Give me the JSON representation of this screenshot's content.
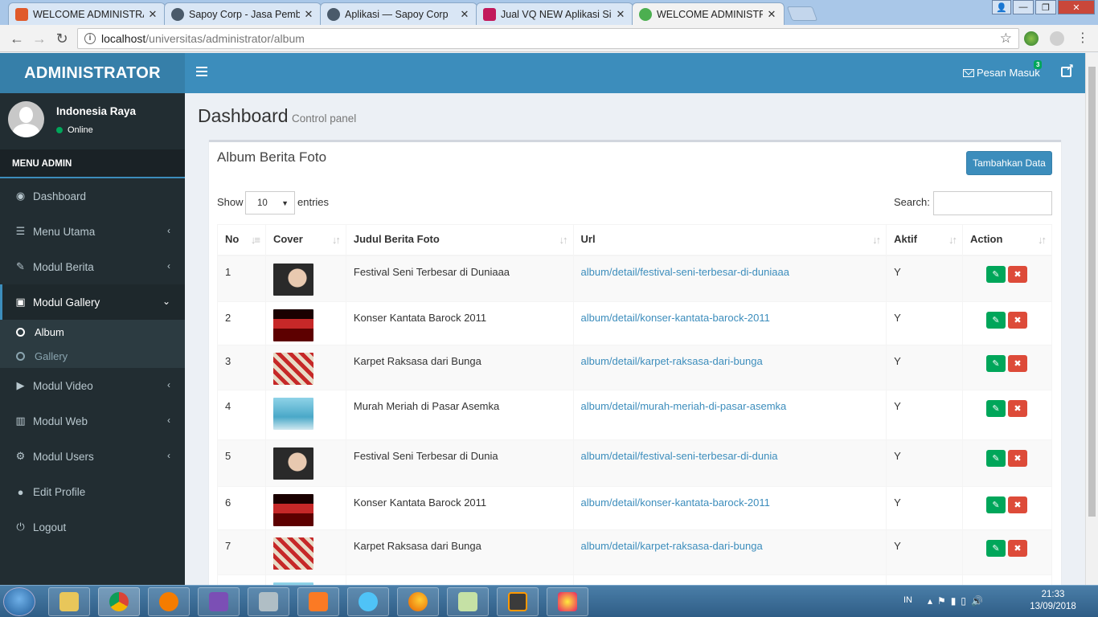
{
  "browser": {
    "tabs": [
      {
        "label": "WELCOME ADMINISTRAT",
        "favicon_color": "#e05a2b",
        "active": false
      },
      {
        "label": "Sapoy Corp - Jasa Pembu",
        "favicon_color": "#4a5a6a",
        "active": false
      },
      {
        "label": "Aplikasi — Sapoy Corp",
        "favicon_color": "#4a5a6a",
        "active": false
      },
      {
        "label": "Jual VQ NEW Aplikasi Sir",
        "favicon_color": "#c2185b",
        "active": false
      },
      {
        "label": "WELCOME ADMINISTRAT",
        "favicon_color": "#4caf50",
        "active": true
      }
    ],
    "url_host": "localhost",
    "url_path": "/universitas/administrator/album"
  },
  "header": {
    "logo": "ADMINISTRATOR",
    "messages_label": "Pesan Masuk",
    "messages_count": "3"
  },
  "sidebar": {
    "user_name": "Indonesia Raya",
    "user_status": "Online",
    "menu_header": "MENU ADMIN",
    "items": [
      {
        "label": "Dashboard",
        "icon": "dashboard-icon"
      },
      {
        "label": "Menu Utama",
        "icon": "list-icon"
      },
      {
        "label": "Modul Berita",
        "icon": "pencil-icon"
      },
      {
        "label": "Modul Gallery",
        "icon": "image-icon"
      },
      {
        "label": "Modul Video",
        "icon": "play-icon"
      },
      {
        "label": "Modul Web",
        "icon": "bar-chart-icon"
      },
      {
        "label": "Modul Users",
        "icon": "cog-icon"
      },
      {
        "label": "Edit Profile",
        "icon": "user-icon"
      },
      {
        "label": "Logout",
        "icon": "power-icon"
      }
    ],
    "gallery_sub": [
      "Album",
      "Gallery"
    ]
  },
  "main": {
    "title": "Dashboard",
    "subtitle": "Control panel",
    "box_title": "Album Berita Foto",
    "add_button": "Tambahkan Data",
    "show_label": "Show",
    "entries_value": "10",
    "entries_label": "entries",
    "search_label": "Search:",
    "columns": [
      "No",
      "Cover",
      "Judul Berita Foto",
      "Url",
      "Aktif",
      "Action"
    ],
    "rows": [
      {
        "no": "1",
        "title": "Festival Seni Terbesar di Duniaaa",
        "url": "album/detail/festival-seni-terbesar-di-duniaaa",
        "aktif": "Y",
        "cover": "portrait"
      },
      {
        "no": "2",
        "title": "Konser Kantata Barock 2011",
        "url": "album/detail/konser-kantata-barock-2011",
        "aktif": "Y",
        "cover": "concert"
      },
      {
        "no": "3",
        "title": "Karpet Raksasa dari Bunga",
        "url": "album/detail/karpet-raksasa-dari-bunga",
        "aktif": "Y",
        "cover": "flowers"
      },
      {
        "no": "4",
        "title": "Murah Meriah di Pasar Asemka",
        "url": "album/detail/murah-meriah-di-pasar-asemka",
        "aktif": "Y",
        "cover": "market"
      },
      {
        "no": "5",
        "title": "Festival Seni Terbesar di Dunia",
        "url": "album/detail/festival-seni-terbesar-di-dunia",
        "aktif": "Y",
        "cover": "portrait"
      },
      {
        "no": "6",
        "title": "Konser Kantata Barock 2011",
        "url": "album/detail/konser-kantata-barock-2011",
        "aktif": "Y",
        "cover": "concert"
      },
      {
        "no": "7",
        "title": "Karpet Raksasa dari Bunga",
        "url": "album/detail/karpet-raksasa-dari-bunga",
        "aktif": "Y",
        "cover": "flowers"
      },
      {
        "no": "",
        "title": "",
        "url": "",
        "aktif": "",
        "cover": "market"
      }
    ]
  },
  "taskbar": {
    "lang": "IN",
    "time": "21:33",
    "date": "13/09/2018"
  },
  "colors": {
    "brand_dark": "#367fa9",
    "brand": "#3c8dbc",
    "sidebar": "#222d32",
    "success": "#00a65a",
    "danger": "#dd4b39"
  }
}
